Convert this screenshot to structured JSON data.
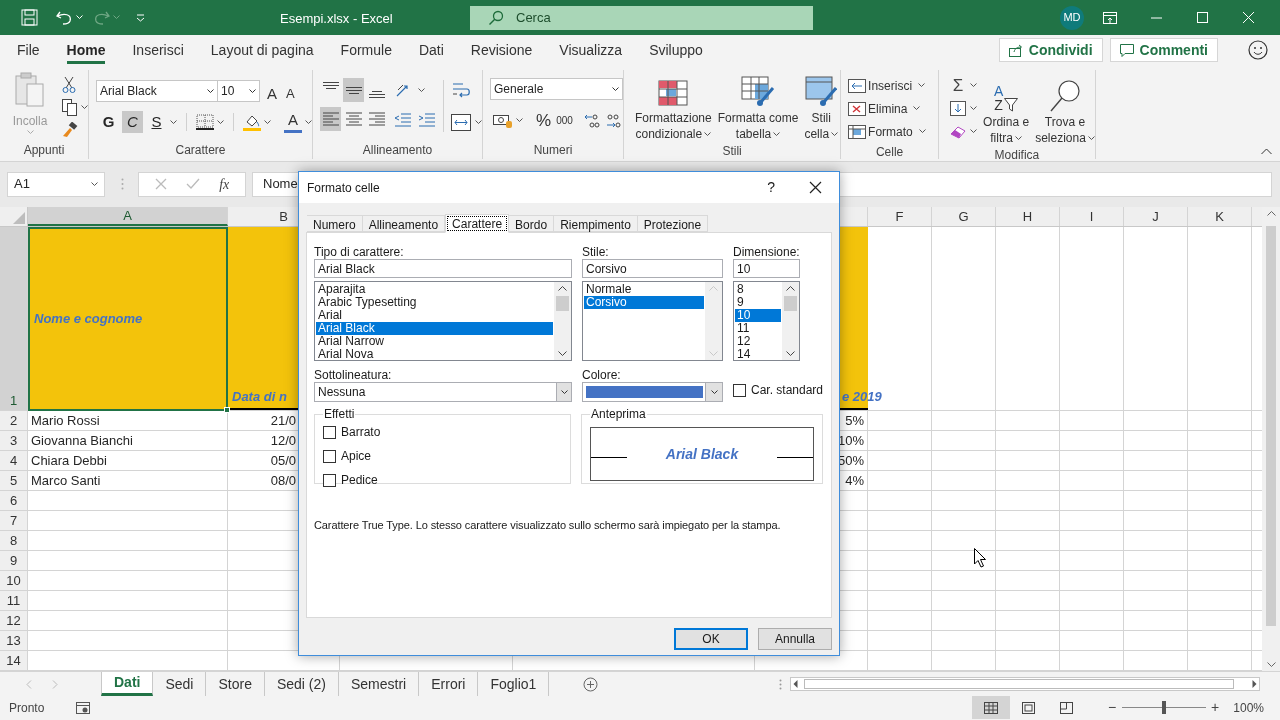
{
  "window": {
    "title": "Esempi.xlsx - Excel",
    "search": {
      "placeholder": "Cerca"
    },
    "avatar": "MD",
    "redo_disabled": true
  },
  "menu_tabs": [
    {
      "label": "File",
      "selected": false
    },
    {
      "label": "Home",
      "selected": true
    },
    {
      "label": "Inserisci",
      "selected": false
    },
    {
      "label": "Layout di pagina",
      "selected": false
    },
    {
      "label": "Formule",
      "selected": false
    },
    {
      "label": "Dati",
      "selected": false
    },
    {
      "label": "Revisione",
      "selected": false
    },
    {
      "label": "Visualizza",
      "selected": false
    },
    {
      "label": "Sviluppo",
      "selected": false
    }
  ],
  "actions": [
    {
      "label": "Condividi",
      "kind": "share"
    },
    {
      "label": "Commenti",
      "kind": "comment"
    }
  ],
  "ribbon": {
    "clipboard": {
      "label": "Appunti",
      "paste": "Incolla"
    },
    "font": {
      "label": "Carattere",
      "font_name": "Arial Black",
      "font_size": "10",
      "grow": "A",
      "shrink": "A",
      "bold": {
        "label": "G",
        "on": false
      },
      "italic": {
        "label": "C",
        "on": true
      },
      "underline": {
        "label": "S",
        "on": false
      },
      "font_color": "A"
    },
    "alignment": {
      "label": "Allineamento",
      "vertical": [
        {
          "kind": "top",
          "on": false
        },
        {
          "kind": "middle",
          "on": true
        },
        {
          "kind": "bottom",
          "on": false
        }
      ],
      "horizontal": [
        {
          "kind": "left",
          "on": true
        },
        {
          "kind": "center",
          "on": false
        },
        {
          "kind": "right",
          "on": false
        }
      ]
    },
    "number": {
      "label": "Numeri",
      "format": "Generale",
      "percent": "%",
      "thousands": "000"
    },
    "styles": {
      "label": "Stili",
      "buttons": [
        {
          "kind": "conditional",
          "lines": [
            "Formattazione",
            "condizionale"
          ]
        },
        {
          "kind": "table",
          "lines": [
            "Formatta come",
            "tabella"
          ]
        },
        {
          "kind": "cell",
          "lines": [
            "Stili",
            "cella"
          ]
        }
      ]
    },
    "cells": {
      "label": "Celle",
      "buttons": [
        {
          "kind": "insert",
          "label": "Inserisci"
        },
        {
          "kind": "delete",
          "label": "Elimina"
        },
        {
          "kind": "format",
          "label": "Formato"
        }
      ]
    },
    "editing": {
      "label": "Modifica",
      "autosum": "Σ",
      "sort_letters": [
        "A",
        "Z"
      ],
      "buttons": [
        {
          "kind": "sort",
          "lines": [
            "Ordina e",
            "filtra"
          ]
        },
        {
          "kind": "find",
          "lines": [
            "Trova e",
            "seleziona"
          ]
        }
      ]
    }
  },
  "formula_bar": {
    "name_box": "A1",
    "function_label": "fx",
    "content": "Nome"
  },
  "sheet": {
    "columns": [
      {
        "letter": "A",
        "selected": true
      },
      {
        "letter": "B",
        "selected": false
      },
      {
        "letter": "F",
        "selected": false
      },
      {
        "letter": "G",
        "selected": false
      },
      {
        "letter": "H",
        "selected": false
      },
      {
        "letter": "I",
        "selected": false
      },
      {
        "letter": "J",
        "selected": false
      },
      {
        "letter": "K",
        "selected": false
      }
    ],
    "rows": [
      {
        "number": "1",
        "selected": true,
        "kind": "header",
        "cells": [
          "Nome e cognome",
          "Data di n",
          "e 2019"
        ]
      },
      {
        "number": "2",
        "selected": false,
        "kind": "data",
        "cells": [
          "Mario Rossi",
          "21/0",
          "5%"
        ]
      },
      {
        "number": "3",
        "selected": false,
        "kind": "data",
        "cells": [
          "Giovanna Bianchi",
          "12/0",
          "10%"
        ]
      },
      {
        "number": "4",
        "selected": false,
        "kind": "data",
        "cells": [
          "Chiara Debbi",
          "05/0",
          "50%"
        ]
      },
      {
        "number": "5",
        "selected": false,
        "kind": "data",
        "cells": [
          "Marco Santi",
          "08/0",
          "4%"
        ]
      },
      {
        "number": "6",
        "selected": false,
        "kind": "empty"
      },
      {
        "number": "7",
        "selected": false,
        "kind": "empty"
      },
      {
        "number": "8",
        "selected": false,
        "kind": "empty"
      },
      {
        "number": "9",
        "selected": false,
        "kind": "empty"
      },
      {
        "number": "10",
        "selected": false,
        "kind": "empty"
      },
      {
        "number": "11",
        "selected": false,
        "kind": "empty"
      },
      {
        "number": "12",
        "selected": false,
        "kind": "empty"
      },
      {
        "number": "13",
        "selected": false,
        "kind": "empty"
      },
      {
        "number": "14",
        "selected": false,
        "kind": "empty"
      }
    ]
  },
  "dialog": {
    "title": "Formato celle",
    "help": "?",
    "tabs": [
      {
        "label": "Numero",
        "selected": false
      },
      {
        "label": "Allineamento",
        "selected": false
      },
      {
        "label": "Carattere",
        "selected": true
      },
      {
        "label": "Bordo",
        "selected": false
      },
      {
        "label": "Riempimento",
        "selected": false
      },
      {
        "label": "Protezione",
        "selected": false
      }
    ],
    "font": {
      "label": "Tipo di carattere:",
      "value": "Arial Black",
      "items": [
        {
          "label": "Aparajita",
          "selected": false
        },
        {
          "label": "Arabic Typesetting",
          "selected": false
        },
        {
          "label": "Arial",
          "selected": false
        },
        {
          "label": "Arial Black",
          "selected": true
        },
        {
          "label": "Arial Narrow",
          "selected": false
        },
        {
          "label": "Arial Nova",
          "selected": false
        }
      ]
    },
    "style": {
      "label": "Stile:",
      "value": "Corsivo",
      "items": [
        {
          "label": "Normale",
          "selected": false
        },
        {
          "label": "Corsivo",
          "selected": true
        }
      ]
    },
    "size": {
      "label": "Dimensione:",
      "value": "10",
      "items": [
        {
          "label": "8",
          "selected": false
        },
        {
          "label": "9",
          "selected": false
        },
        {
          "label": "10",
          "selected": true
        },
        {
          "label": "11",
          "selected": false
        },
        {
          "label": "12",
          "selected": false
        },
        {
          "label": "14",
          "selected": false
        }
      ]
    },
    "underline": {
      "label": "Sottolineatura:",
      "value": "Nessuna"
    },
    "color": {
      "label": "Colore:",
      "color": "#4472c4"
    },
    "normal_font": {
      "label": "Car. standard",
      "checked": false
    },
    "effects": {
      "label": "Effetti",
      "items": [
        {
          "label": "Barrato",
          "checked": false
        },
        {
          "label": "Apice",
          "checked": false
        },
        {
          "label": "Pedice",
          "checked": false
        }
      ]
    },
    "preview": {
      "label": "Anteprima",
      "text": "Arial Black"
    },
    "note": "Carattere True Type. Lo stesso carattere visualizzato sullo schermo sarà impiegato per la stampa.",
    "buttons": [
      {
        "label": "OK",
        "default": true
      },
      {
        "label": "Annulla",
        "default": false
      }
    ]
  },
  "sheet_tabs": [
    {
      "label": "Dati",
      "selected": true
    },
    {
      "label": "Sedi",
      "selected": false
    },
    {
      "label": "Store",
      "selected": false
    },
    {
      "label": "Sedi (2)",
      "selected": false
    },
    {
      "label": "Semestri",
      "selected": false
    },
    {
      "label": "Errori",
      "selected": false
    },
    {
      "label": "Foglio1",
      "selected": false
    }
  ],
  "status_bar": {
    "status": "Pronto",
    "views": [
      {
        "kind": "normal",
        "selected": true
      },
      {
        "kind": "page_layout",
        "selected": false
      },
      {
        "kind": "page_break",
        "selected": false
      }
    ],
    "zoom": {
      "out": "−",
      "in": "+",
      "level": 0.5,
      "reading": "100%"
    }
  }
}
